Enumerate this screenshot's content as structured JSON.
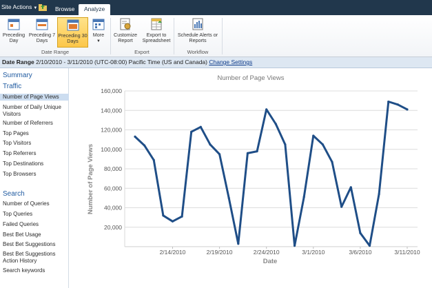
{
  "topbar": {
    "site_actions": "Site Actions",
    "tabs": [
      {
        "label": "Browse"
      },
      {
        "label": "Analyze"
      }
    ]
  },
  "ribbon": {
    "buttons": [
      {
        "label": "Preceding Day",
        "icon": "calendar-day-icon",
        "selected": false
      },
      {
        "label": "Preceding 7 Days",
        "icon": "calendar-week-icon",
        "selected": false
      },
      {
        "label": "Preceding 30 Days",
        "icon": "calendar-month-icon",
        "selected": true
      },
      {
        "label": "More",
        "icon": "calendar-more-icon",
        "selected": false
      },
      {
        "label": "Customize Report",
        "icon": "customize-report-icon",
        "selected": false
      },
      {
        "label": "Export to Spreadsheet",
        "icon": "export-spreadsheet-icon",
        "selected": false
      },
      {
        "label": "Schedule Alerts or Reports",
        "icon": "schedule-alerts-icon",
        "selected": false
      }
    ],
    "groups": [
      {
        "label": "Date Range"
      },
      {
        "label": "Export"
      },
      {
        "label": "Workflow"
      }
    ]
  },
  "date_range": {
    "label": "Date Range",
    "value": "2/10/2010 - 3/11/2010 (UTC-08:00) Pacific Time (US and Canada)",
    "change_link": "Change Settings"
  },
  "leftnav": {
    "summary": "Summary",
    "traffic": "Traffic",
    "traffic_items": [
      "Number of Page Views",
      "Number of Daily Unique Visitors",
      "Number of Referrers",
      "Top Pages",
      "Top Visitors",
      "Top Referrers",
      "Top Destinations",
      "Top Browsers"
    ],
    "search": "Search",
    "search_items": [
      "Number of Queries",
      "Top Queries",
      "Failed Queries",
      "Best Bet Usage",
      "Best Bet Suggestions",
      "Best Bet Suggestions Action History",
      "Search keywords"
    ],
    "active_index": 0
  },
  "colors": {
    "topbar": "#21374c",
    "line": "#1f4e87",
    "link": "#0d3b8a",
    "selected_button": "#fcc74a",
    "active_nav": "#ccddf0"
  },
  "chart_data": {
    "type": "line",
    "title": "Number of Page Views",
    "xlabel": "Date",
    "ylabel": "Number of Page Views",
    "ylim": [
      0,
      160000
    ],
    "yticks": [
      20000,
      40000,
      60000,
      80000,
      100000,
      120000,
      140000,
      160000
    ],
    "ytick_labels": [
      "20,000",
      "40,000",
      "60,000",
      "80,000",
      "100,000",
      "120,000",
      "140,000",
      "160,000"
    ],
    "xtick_labels": [
      "2/14/2010",
      "2/19/2010",
      "2/24/2010",
      "3/1/2010",
      "3/6/2010",
      "3/11/2010"
    ],
    "grid": true,
    "series": [
      {
        "x": [
          "2010-02-10",
          "2010-02-11",
          "2010-02-12",
          "2010-02-13",
          "2010-02-14",
          "2010-02-15",
          "2010-02-16",
          "2010-02-17",
          "2010-02-18",
          "2010-02-19",
          "2010-02-20",
          "2010-02-21",
          "2010-02-22",
          "2010-02-23",
          "2010-02-24",
          "2010-02-25",
          "2010-02-26",
          "2010-02-27",
          "2010-02-28",
          "2010-03-01",
          "2010-03-02",
          "2010-03-03",
          "2010-03-04",
          "2010-03-05",
          "2010-03-06",
          "2010-03-07",
          "2010-03-08",
          "2010-03-09",
          "2010-03-10",
          "2010-03-11"
        ],
        "values": [
          113000,
          104000,
          89000,
          32000,
          26000,
          31000,
          118000,
          123000,
          105000,
          95000,
          50000,
          3000,
          96000,
          98000,
          141000,
          126000,
          105000,
          1000,
          51000,
          114000,
          105000,
          87000,
          41000,
          61000,
          14000,
          1000,
          54000,
          149000,
          146000,
          141000
        ]
      }
    ]
  }
}
